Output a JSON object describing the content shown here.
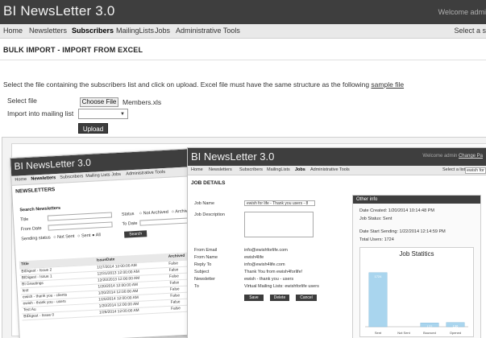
{
  "app": {
    "title": "BI NewsLetter 3.0",
    "welcome": "Welcome admi"
  },
  "nav": {
    "items": [
      "Home",
      "Newsletters",
      "Subscribers",
      "MailingLists",
      "Jobs",
      "Administrative Tools"
    ],
    "active": "Subscribers",
    "select_label": "Select a s"
  },
  "page": {
    "title": "BULK IMPORT - IMPORT FROM EXCEL",
    "instruction": "Select the file containing the subscribers list and click on upload. Excel file must have the same structure as the following",
    "sample_link": "sample file",
    "file_label": "Select file",
    "file_button": "Choose File",
    "file_name": "Members.xls",
    "mailing_label": "Import into mailing list",
    "mailing_value": "",
    "upload_button": "Upload"
  },
  "card_newsletters": {
    "title": "BI NewsLetter 3.0",
    "nav": [
      "Home",
      "Newsletters",
      "Subscribers",
      "Mailing Lists",
      "Jobs",
      "Administrative Tools"
    ],
    "active": "Newsletters",
    "heading": "NEWSLETTERS",
    "search_heading": "Search Newsletters",
    "title_label": "Title",
    "from_date_label": "From Date",
    "to_date_label": "To Date",
    "status_label": "Status",
    "status_opt1": "Not Archived",
    "status_opt2": "Archived",
    "sending_label": "Sending status",
    "sending_opt1": "Not Sent",
    "sending_opt2": "Sent",
    "sending_opt3": "All",
    "search_button": "Search",
    "table_headers": [
      "Title",
      "IssueDate",
      "Archived"
    ],
    "rows": [
      [
        "BIDigest - Issue 2",
        "1/27/2014 12:00:00 AM",
        "False"
      ],
      [
        "BIDigest - Issue 1",
        "12/31/2013 12:00:00 AM",
        "False"
      ],
      [
        "BI Greetings",
        "12/20/2013 12:00:00 AM",
        "False"
      ],
      [
        "test",
        "1/20/2014 12:00:00 AM",
        "False"
      ],
      [
        "ewish - thank you - clients",
        "1/20/2014 12:00:00 AM",
        "False"
      ],
      [
        "ewish - thank you - users",
        "1/20/2014 12:00:00 AM",
        "False"
      ],
      [
        "Test Au",
        "1/20/2014 12:00:00 AM",
        "False"
      ],
      [
        "BIDigest - Issue 0",
        "1/29/2014 12:00:00 AM",
        "False"
      ]
    ]
  },
  "card_job": {
    "title": "BI NewsLetter 3.0",
    "welcome": "Welcome admin",
    "change_link": "Change Pa",
    "nav": [
      "Home",
      "Newsletters",
      "Subscribers",
      "MailingLists",
      "Jobs",
      "Administrative Tools"
    ],
    "active": "Jobs",
    "select_label": "Select a list",
    "select_value": "ewish for",
    "heading": "JOB DETAILS",
    "job_name_label": "Job Name",
    "job_name_value": "ewish for life - Thank you users - 8",
    "job_desc_label": "Job Description",
    "fields": [
      {
        "label": "From Email",
        "value": "info@ewishforlife.com"
      },
      {
        "label": "From Name",
        "value": "ewish4life"
      },
      {
        "label": "Reply To",
        "value": "info@ewish4life.com"
      },
      {
        "label": "Subject",
        "value": "Thank You from ewish4forlife!"
      },
      {
        "label": "Newsletter",
        "value": "ewish - thank you - users"
      },
      {
        "label": "To",
        "value": "Virtual Mailing Lists: ewishforlife users"
      }
    ],
    "buttons": [
      "Save",
      "Delete",
      "Cancel"
    ],
    "info_title": "Other info",
    "info_lines": [
      "Date Created: 1/20/2014 10:14:48 PM",
      "Job Status: Sent",
      "Date Start Sending: 1/22/2014 12:14:59 PM",
      "Total Users: 1724"
    ],
    "chart_title": "Job Statitics"
  },
  "chart_data": {
    "type": "bar",
    "title": "Job Statitics",
    "categories": [
      "Sent",
      "Not Sent",
      "Bounced",
      "Opened"
    ],
    "values": [
      1724,
      0,
      122,
      136
    ],
    "data_labels": [
      "1724",
      "",
      "122",
      "136"
    ],
    "ylim": [
      0,
      2000
    ],
    "colors": [
      "#a9d5ee",
      "#a9d5ee",
      "#a9d5ee",
      "#a9d5ee"
    ]
  },
  "colors": {
    "header": "#3e3e3e",
    "nav": "#e9e9e9",
    "button": "#3d3d3d"
  }
}
